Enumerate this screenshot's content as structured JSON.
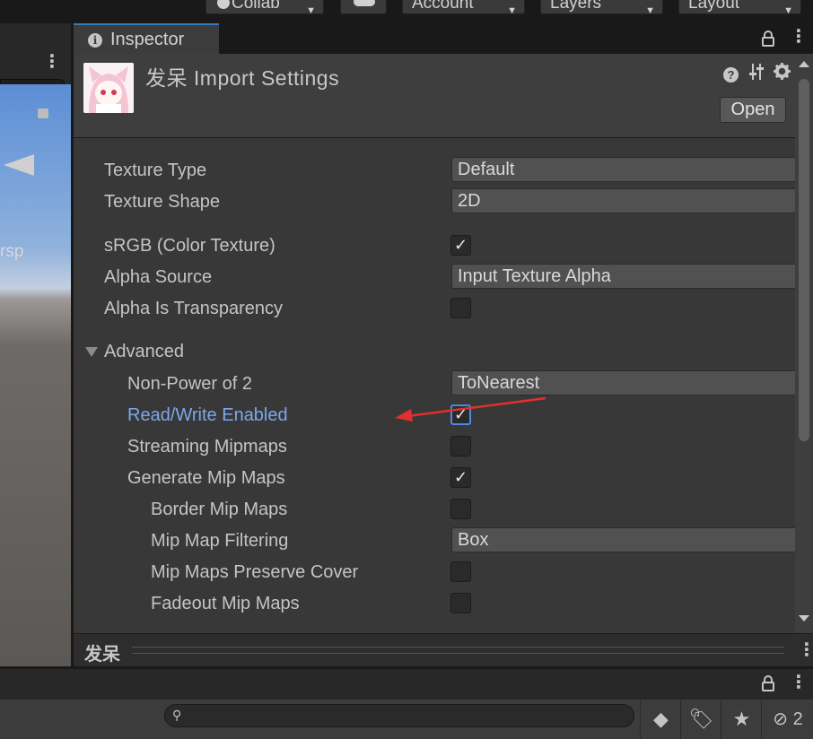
{
  "toolbar": {
    "collab_label": "Collab",
    "account_label": "Account",
    "layers_label": "Layers",
    "layout_label": "Layout"
  },
  "scene": {
    "persp_label": "rsp"
  },
  "inspector": {
    "tab_label": "Inspector",
    "title": "发呆 Import Settings",
    "open_label": "Open",
    "icons": [
      "help-icon",
      "preset-sliders-icon",
      "gear-icon",
      "lock-icon",
      "kebab-menu-icon"
    ]
  },
  "settings": {
    "texture_type": {
      "label": "Texture Type",
      "value": "Default"
    },
    "texture_shape": {
      "label": "Texture Shape",
      "value": "2D"
    },
    "srgb": {
      "label": "sRGB (Color Texture)",
      "checked": true
    },
    "alpha_source": {
      "label": "Alpha Source",
      "value": "Input Texture Alpha"
    },
    "alpha_is_transparency": {
      "label": "Alpha Is Transparency",
      "checked": false
    },
    "advanced": {
      "label": "Advanced",
      "expanded": true
    },
    "non_power_of_2": {
      "label": "Non-Power of 2",
      "value": "ToNearest"
    },
    "read_write": {
      "label": "Read/Write Enabled",
      "checked": true
    },
    "streaming_mipmaps": {
      "label": "Streaming Mipmaps",
      "checked": false
    },
    "generate_mip_maps": {
      "label": "Generate Mip Maps",
      "checked": true
    },
    "border_mip_maps": {
      "label": "Border Mip Maps",
      "checked": false
    },
    "mip_map_filtering": {
      "label": "Mip Map Filtering",
      "value": "Box"
    },
    "mip_maps_preserve_coverage": {
      "label": "Mip Maps Preserve Cover",
      "checked": false
    },
    "fadeout_mip_maps": {
      "label": "Fadeout Mip Maps",
      "checked": false
    }
  },
  "preview": {
    "title": "发呆"
  },
  "lower_panel": {
    "search_placeholder": "",
    "hidden_count": "2"
  },
  "annotation": {
    "arrow_color": "#e0312f"
  },
  "colors": {
    "accent": "#3a79bb",
    "highlight_label": "#7ba8ea"
  }
}
